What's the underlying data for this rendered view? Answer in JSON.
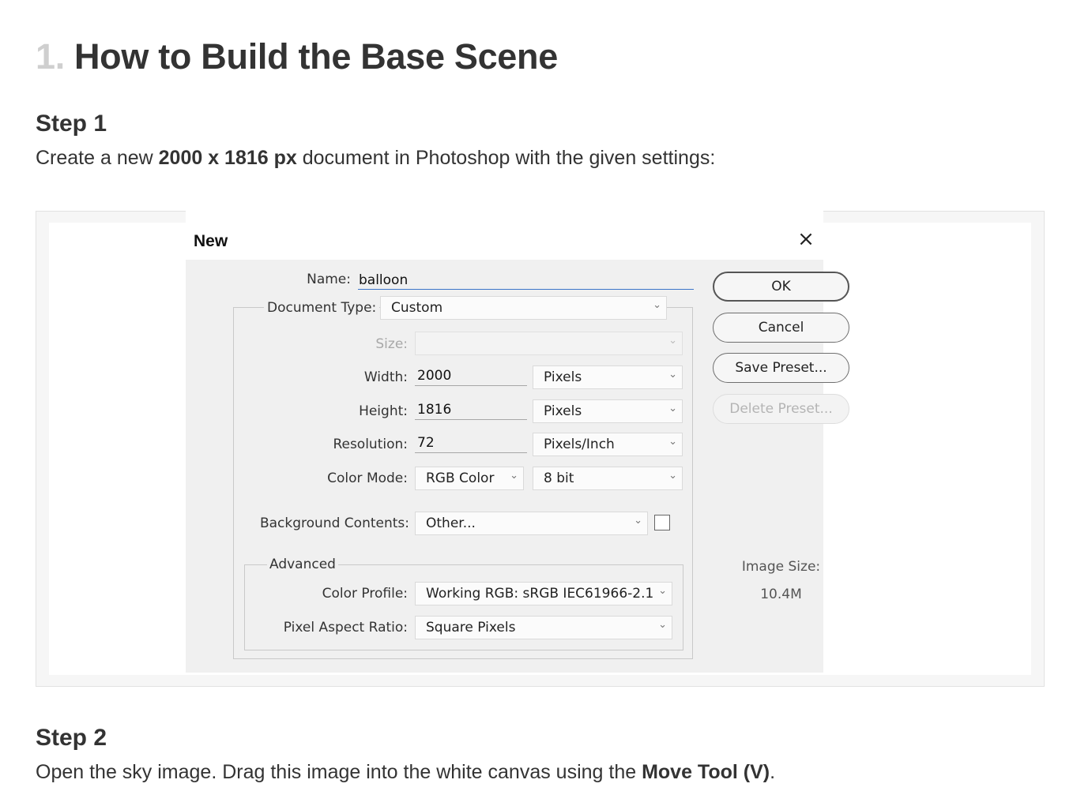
{
  "article": {
    "title_number": "1.",
    "title_text": "How to Build the Base Scene",
    "step1": {
      "heading": "Step 1",
      "text_before": "Create a new ",
      "text_bold": "2000 x 1816 px",
      "text_after": " document in Photoshop with the given settings:"
    },
    "step2": {
      "heading": "Step 2",
      "text_before": "Open the sky image. Drag this image into the white canvas using the ",
      "text_bold": "Move Tool (V)",
      "text_after": "."
    }
  },
  "dialog": {
    "title": "New",
    "close_glyph": "×",
    "name_label": "Name:",
    "name_value": "balloon",
    "document_type_label": "Document Type:",
    "document_type_value": "Custom",
    "size_label": "Size:",
    "size_value": "",
    "width_label": "Width:",
    "width_value": "2000",
    "width_unit": "Pixels",
    "height_label": "Height:",
    "height_value": "1816",
    "height_unit": "Pixels",
    "resolution_label": "Resolution:",
    "resolution_value": "72",
    "resolution_unit": "Pixels/Inch",
    "color_mode_label": "Color Mode:",
    "color_mode_value": "RGB Color",
    "bit_depth_value": "8 bit",
    "background_label": "Background Contents:",
    "background_value": "Other...",
    "advanced_label": "Advanced",
    "color_profile_label": "Color Profile:",
    "color_profile_value": "Working RGB:  sRGB IEC61966-2.1",
    "pixel_aspect_label": "Pixel Aspect Ratio:",
    "pixel_aspect_value": "Square Pixels",
    "buttons": {
      "ok": "OK",
      "cancel": "Cancel",
      "save_preset": "Save Preset...",
      "delete_preset": "Delete Preset..."
    },
    "image_size_label": "Image Size:",
    "image_size_value": "10.4M"
  },
  "colors": {
    "focus_underline": "#3b74c9",
    "dialog_bg": "#f0f0f0",
    "title_number": "#cfcfcf"
  }
}
